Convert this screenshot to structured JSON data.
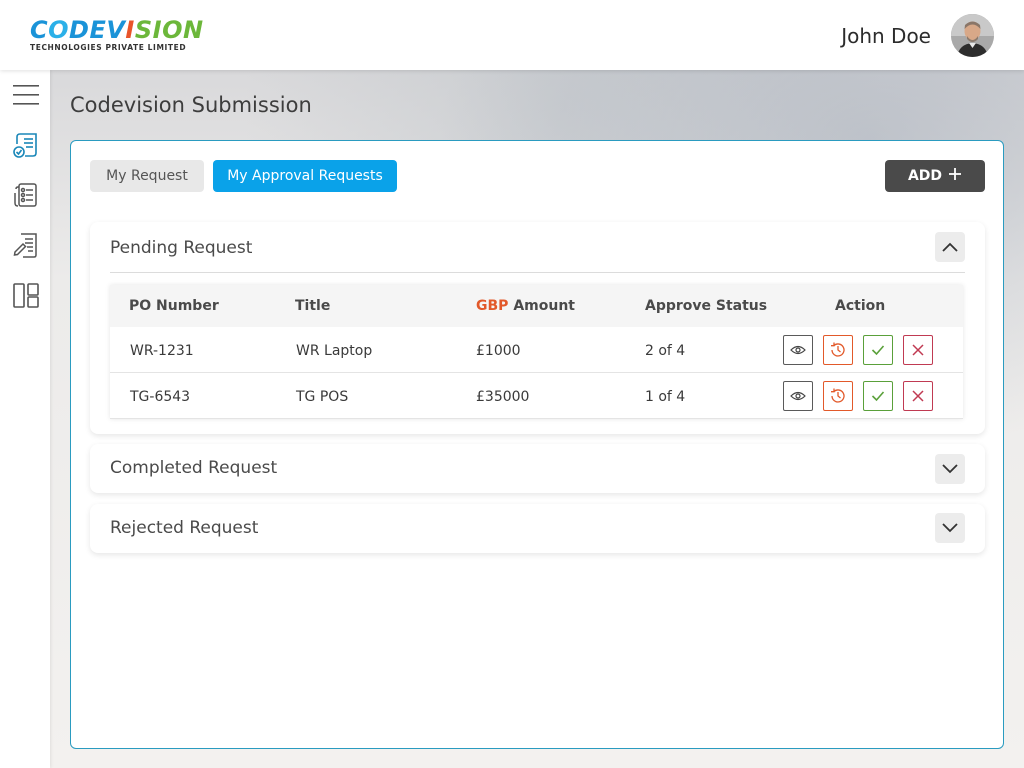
{
  "header": {
    "logo_main_parts": [
      "C",
      "O",
      "DEV",
      "I",
      "SION"
    ],
    "logo_sub": "TECHNOLOGIES PRIVATE LIMITED",
    "user_name": "John Doe"
  },
  "sidebar": {
    "items": [
      {
        "icon": "hamburger-menu-icon"
      },
      {
        "icon": "document-check-icon",
        "active": true
      },
      {
        "icon": "document-list-icon"
      },
      {
        "icon": "document-edit-icon"
      },
      {
        "icon": "layout-panels-icon"
      }
    ]
  },
  "page": {
    "title": "Codevision Submission"
  },
  "tabs": [
    {
      "label": "My Request",
      "active": false
    },
    {
      "label": "My Approval Requests",
      "active": true
    }
  ],
  "add_button": {
    "label": "ADD"
  },
  "sections": {
    "pending": {
      "title": "Pending Request",
      "expanded": true
    },
    "completed": {
      "title": "Completed Request",
      "expanded": false
    },
    "rejected": {
      "title": "Rejected Request",
      "expanded": false
    }
  },
  "table": {
    "headers": {
      "po_number": "PO Number",
      "title": "Title",
      "currency": "GBP",
      "amount": "Amount",
      "approve_status": "Approve Status",
      "action": "Action"
    },
    "rows": [
      {
        "po": "WR-1231",
        "title": "WR Laptop",
        "amount": "£1000",
        "status": "2 of 4"
      },
      {
        "po": "TG-6543",
        "title": "TG POS",
        "amount": "£35000",
        "status": "1 of 4"
      }
    ]
  },
  "colors": {
    "accent": "#0aa2e9",
    "currency_highlight": "#e2592a",
    "approve": "#5aa03a",
    "reject": "#c03a52",
    "card_border": "#2a9bc0"
  }
}
